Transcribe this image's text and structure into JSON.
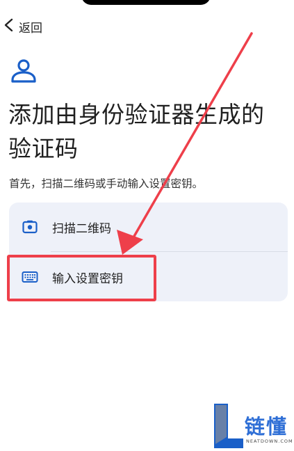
{
  "nav": {
    "back_label": "返回"
  },
  "page": {
    "title": "添加由身份验证器生成的验证码",
    "subtitle": "首先，扫描二维码或手动输入设置密钥。"
  },
  "options": [
    {
      "label": "扫描二维码",
      "icon": "camera-icon"
    },
    {
      "label": "输入设置密钥",
      "icon": "keyboard-icon"
    }
  ],
  "watermark": {
    "brand": "链懂",
    "domain": "NEATDOWN.COM"
  },
  "colors": {
    "accent_blue": "#1a5fc8",
    "card_bg": "#eef1f9",
    "annotation_red": "#ee3f4a"
  }
}
